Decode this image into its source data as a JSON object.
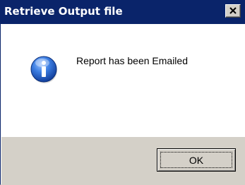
{
  "window": {
    "title": "Retrieve Output file",
    "close_icon": "close-x"
  },
  "message": {
    "icon": "information-icon",
    "text": "Report has been Emailed"
  },
  "buttons": {
    "ok_label": "OK"
  },
  "colors": {
    "titlebar": "#0a246a",
    "title_text": "#ffffff",
    "footer": "#d4d0c8",
    "icon_blue": "#2f6fd6"
  }
}
